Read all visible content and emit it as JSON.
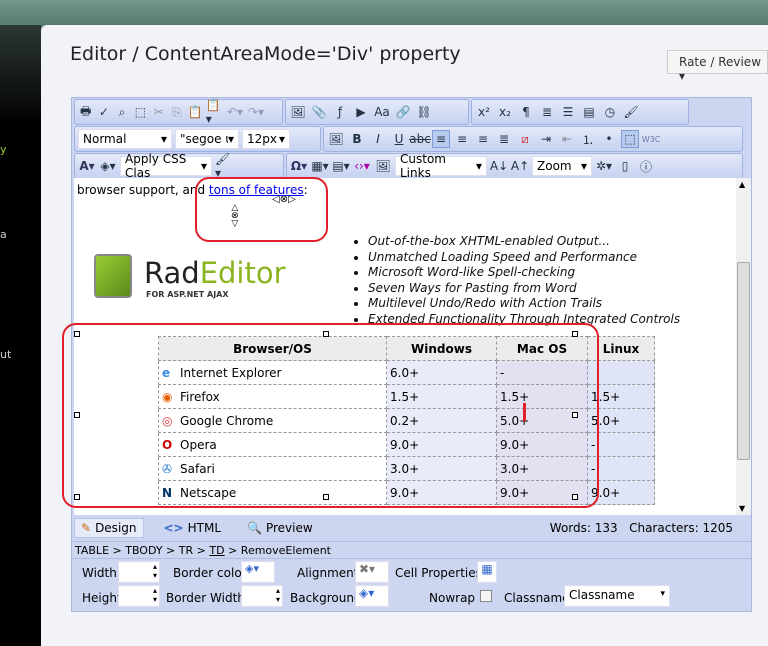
{
  "sidebar": {
    "fragments": [
      "y",
      "a",
      "ut"
    ]
  },
  "page": {
    "title": "Editor / ContentAreaMode='Div' property",
    "rate_review": "Rate / Review"
  },
  "toolbar": {
    "paragraph": "Normal",
    "font": "\"segoe ui\",arial,",
    "size": "12px",
    "css_class": "Apply CSS Clas",
    "links": "Custom Links",
    "zoom": "Zoom"
  },
  "content": {
    "intro": "browser support, and ",
    "link": "tons of features",
    "colon": ":",
    "logo": {
      "rad": "Rad",
      "editor": "Editor",
      "sub": "FOR ASP.NET AJAX"
    },
    "features": [
      "Out-of-the-box XHTML-enabled Output...",
      "Unmatched Loading Speed and Performance",
      "Microsoft Word-like Spell-checking",
      "Seven Ways for Pasting from Word",
      "Multilevel Undo/Redo with Action Trails",
      "Extended Functionality Through Integrated Controls"
    ],
    "table": {
      "headers": [
        "Browser/OS",
        "Windows",
        "Mac OS",
        "Linux"
      ],
      "rows": [
        [
          "Internet Explorer",
          "6.0+",
          "-",
          ""
        ],
        [
          "Firefox",
          "1.5+",
          "1.5+",
          "1.5+"
        ],
        [
          "Google Chrome",
          "0.2+",
          "5.0+",
          "5.0+"
        ],
        [
          "Opera",
          "9.0+",
          "9.0+",
          "-"
        ],
        [
          "Safari",
          "3.0+",
          "3.0+",
          "-"
        ],
        [
          "Netscape",
          "9.0+",
          "9.0+",
          "9.0+"
        ]
      ]
    }
  },
  "modes": {
    "design": "Design",
    "html": "HTML",
    "preview": "Preview"
  },
  "status": {
    "words": "Words: 133",
    "chars": "Characters: 1205"
  },
  "breadcrumb": {
    "table": "TABLE",
    "tbody": "TBODY",
    "tr": "TR",
    "td": "TD",
    "remove": "RemoveElement",
    "sep": " > "
  },
  "props": {
    "width": "Width",
    "height": "Height",
    "border_color": "Border color",
    "border_width": "Border Width",
    "alignment": "Alignment",
    "background": "Background",
    "cell_props": "Cell Properties",
    "nowrap": "Nowrap",
    "classname": "Classname",
    "classname_value": "Classname"
  }
}
